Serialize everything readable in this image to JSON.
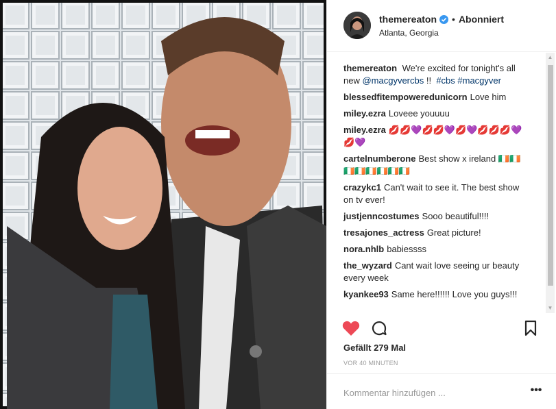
{
  "header": {
    "username": "themereaton",
    "separator": "•",
    "follow_label": "Abonniert",
    "location": "Atlanta, Georgia",
    "avatar_icon": "profile-photo",
    "verified_icon": "verified-badge-icon",
    "verified_color": "#3897f0"
  },
  "comments": [
    {
      "user": "themereaton",
      "text_before": "⁣⁣ We're excited for tonight's all new ",
      "mention": "@macgyvercbs",
      "text_middle": " !! ⁣⁣ ",
      "tags": "#cbs #macgyver"
    },
    {
      "user": "blessedfitempoweredunicorn",
      "text": "Love him"
    },
    {
      "user": "miley.ezra",
      "text": "Loveee youuuu"
    },
    {
      "user": "miley.ezra",
      "text": "💋💋💜💋💋💜💋💜💋💋💋💜💋💜"
    },
    {
      "user": "cartelnumberone",
      "text": "Best show x ireland 🇮🇪🇮🇪🇮🇪🇮🇪🇮🇪🇮🇪🇮🇪🇮🇪"
    },
    {
      "user": "crazykc1",
      "text": "Can't wait to see it. The best show on tv ever!"
    },
    {
      "user": "justjenncostumes",
      "text": "Sooo beautiful!!!!"
    },
    {
      "user": "tresajones_actress",
      "text": "Great picture!"
    },
    {
      "user": "nora.nhlb",
      "text": "babiessss"
    },
    {
      "user": "the_wyzard",
      "text": "Cant wait love seeing ur beauty every week"
    },
    {
      "user": "kyankee93",
      "text": "Same here!!!!!! Love you guys!!!"
    }
  ],
  "actions": {
    "like_icon": "heart-icon",
    "like_color": "#ed4956",
    "comment_icon": "comment-icon",
    "save_icon": "bookmark-icon"
  },
  "likes_text": "Gefällt 279 Mal",
  "timestamp": "VOR 40 MINUTEN",
  "comment_box": {
    "placeholder": "Kommentar hinzufügen ...",
    "more_icon": "more-options-icon",
    "more_label": "•••"
  },
  "scrollbar": {
    "up_arrow": "▲",
    "down_arrow": "▼"
  }
}
